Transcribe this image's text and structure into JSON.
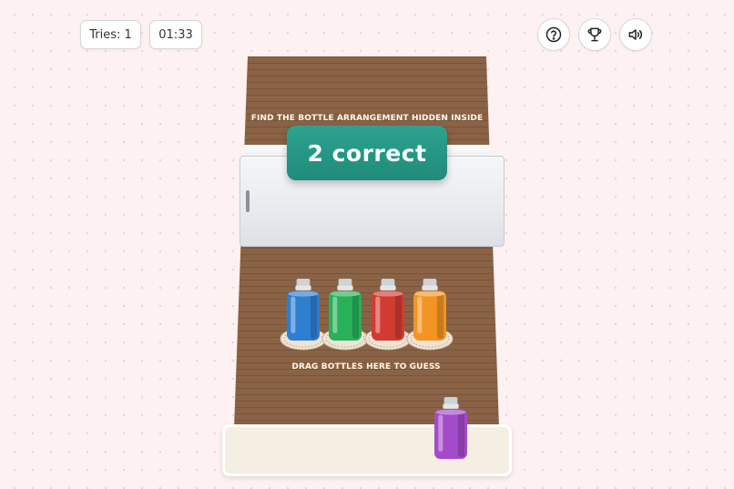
{
  "hud": {
    "tries": "Tries: 1",
    "timer": "01:33"
  },
  "toolbar": {
    "help_icon": "question-circle-icon",
    "trophy_icon": "trophy-icon",
    "sound_icon": "speaker-icon"
  },
  "board": {
    "top_hint": "FIND THE BOTTLE ARRANGEMENT HIDDEN INSIDE",
    "result": "2 correct",
    "guess_hint": "DRAG BOTTLES HERE TO GUESS"
  },
  "guess_slots": [
    {
      "color": "blue",
      "hex": "#2f7fd0"
    },
    {
      "color": "green",
      "hex": "#29b05a"
    },
    {
      "color": "red",
      "hex": "#d23b32"
    },
    {
      "color": "orange",
      "hex": "#f29522"
    }
  ],
  "tray_bottles": [
    {
      "color": "purple",
      "hex": "#a44bc9"
    }
  ],
  "colors": {
    "background": "#fdf1f1",
    "table_wood": "#8a6245",
    "banner": "#249584"
  }
}
